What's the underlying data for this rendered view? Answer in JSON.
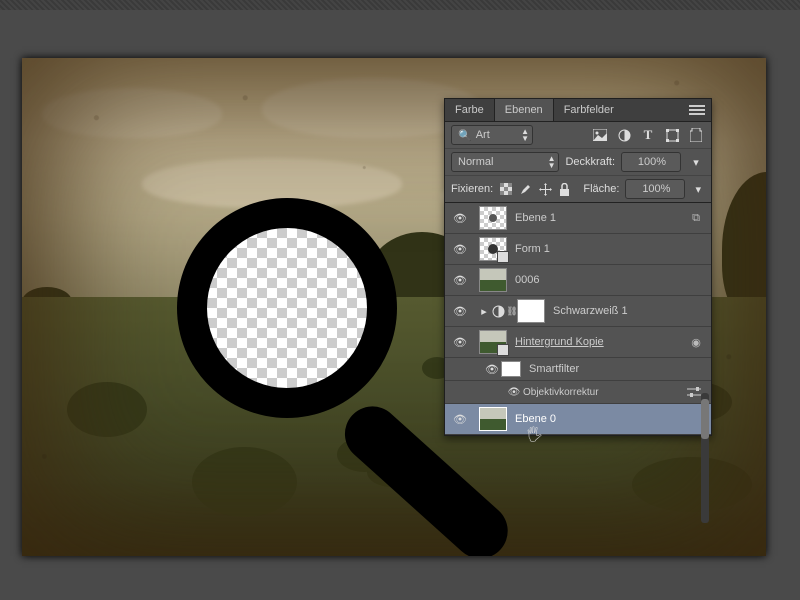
{
  "panel": {
    "tabs": [
      "Farbe",
      "Ebenen",
      "Farbfelder"
    ],
    "active_tab": 1,
    "filter_mode": "Art",
    "type_icons": [
      "image",
      "adjust",
      "text",
      "shape",
      "smart"
    ],
    "blend_mode": "Normal",
    "opacity_label": "Deckkraft:",
    "opacity_value": "100%",
    "lock_label": "Fixieren:",
    "fill_label": "Fläche:",
    "fill_value": "100%",
    "lock_icons": [
      "pixels",
      "brush",
      "move",
      "lock"
    ]
  },
  "layers": [
    {
      "id": "l1",
      "visible": true,
      "thumb": "checker-dot",
      "name": "Ebene 1",
      "end": "link"
    },
    {
      "id": "l2",
      "visible": true,
      "thumb": "checker-smart",
      "name": "Form 1"
    },
    {
      "id": "l3",
      "visible": true,
      "thumb": "photo",
      "name": "0006"
    },
    {
      "id": "l4",
      "visible": true,
      "thumb": "adj",
      "mask": true,
      "name": "Schwarzweiß 1"
    },
    {
      "id": "l5",
      "visible": true,
      "thumb": "photo-smart",
      "underline": true,
      "name": "Hintergrund Kopie",
      "end": "fx"
    },
    {
      "id": "l5a",
      "visible": true,
      "sub": true,
      "thumb": "white",
      "name": "Smartfilter"
    },
    {
      "id": "l5b",
      "visible": true,
      "sub2": true,
      "name": "Objektivkorrektur",
      "end": "sliders"
    },
    {
      "id": "l6",
      "visible": true,
      "thumb": "photo",
      "name": "Ebene 0",
      "selected": true
    }
  ]
}
